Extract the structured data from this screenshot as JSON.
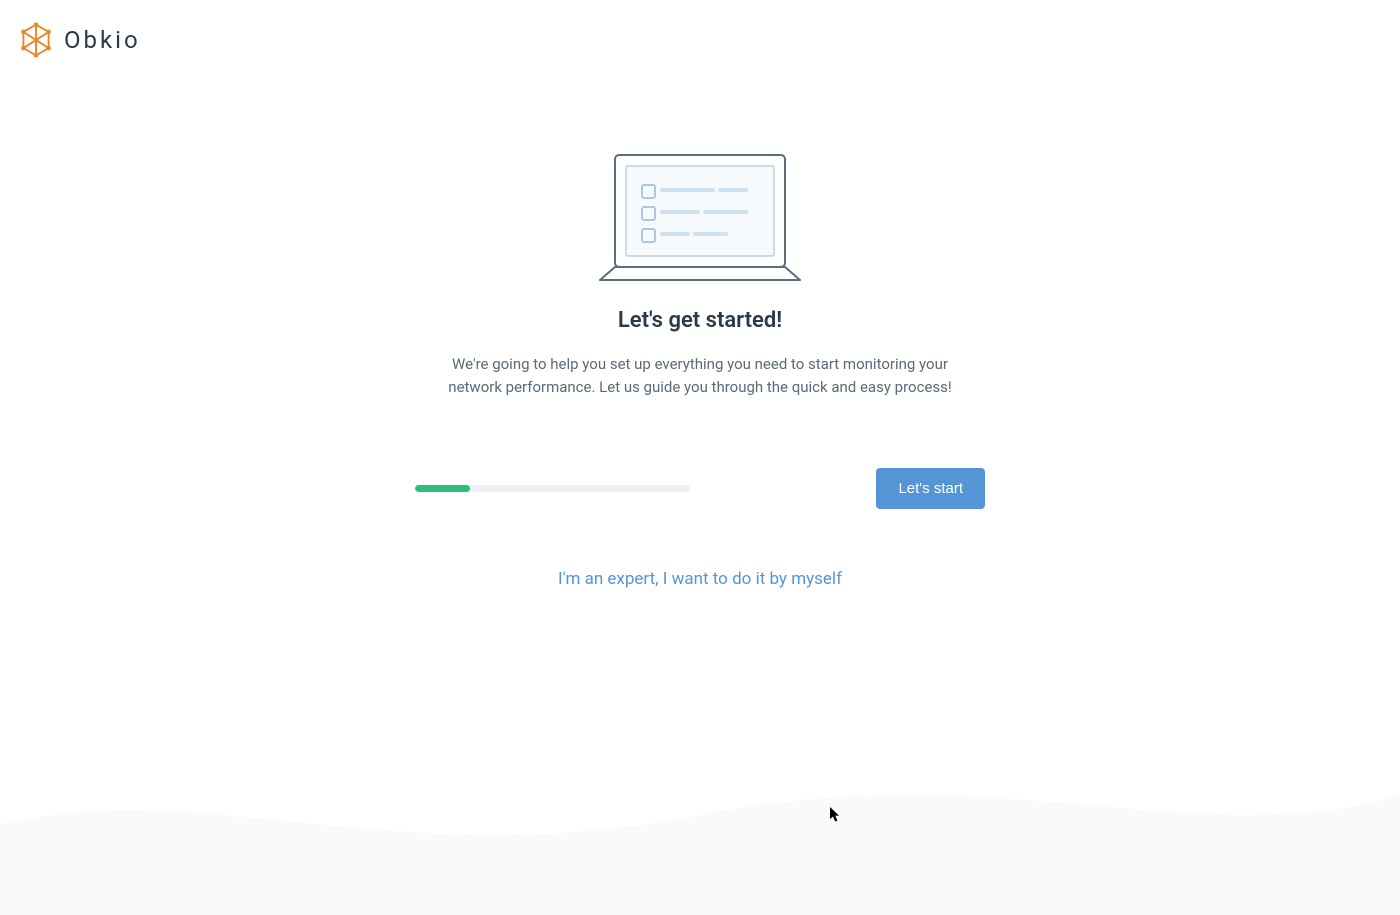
{
  "brand": {
    "name": "Obkio"
  },
  "onboarding": {
    "heading": "Let's get started!",
    "description": "We're going to help you set up everything you need to start monitoring your network performance. Let us guide you through the quick and easy process!",
    "start_button": "Let's start",
    "skip_link": "I'm an expert, I want to do it by myself",
    "progress_percent": 20
  },
  "colors": {
    "brand_accent": "#e88b2d",
    "primary_button": "#5495d6",
    "progress_fill": "#2dbf79",
    "text_heading": "#2a3a4a",
    "text_body": "#5a6a78"
  }
}
